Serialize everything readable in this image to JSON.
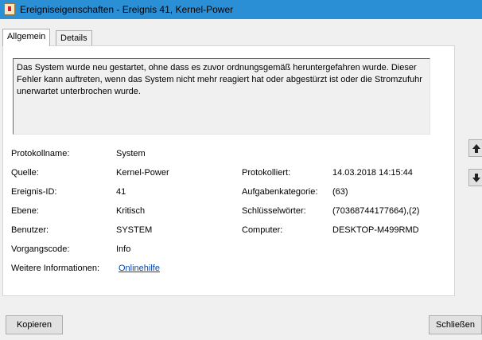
{
  "window": {
    "title": "Ereigniseigenschaften - Ereignis 41, Kernel-Power",
    "icon": "event-log-icon"
  },
  "tabs": [
    {
      "label": "Allgemein",
      "active": true
    },
    {
      "label": "Details",
      "active": false
    }
  ],
  "description": "Das System wurde neu gestartet, ohne dass es zuvor ordnungsgemäß heruntergefahren wurde. Dieser Fehler kann auftreten, wenn das System nicht mehr reagiert hat oder abgestürzt ist oder die Stromzufuhr unerwartet unterbrochen wurde.",
  "fields": {
    "protokollname": {
      "label": "Protokollname:",
      "value": "System"
    },
    "quelle": {
      "label": "Quelle:",
      "value": "Kernel-Power"
    },
    "protokolliert": {
      "label": "Protokolliert:",
      "value": "14.03.2018 14:15:44"
    },
    "ereignis_id": {
      "label": "Ereignis-ID:",
      "value": "41"
    },
    "aufgabenkategorie": {
      "label": "Aufgabenkategorie:",
      "value": "(63)"
    },
    "ebene": {
      "label": "Ebene:",
      "value": "Kritisch"
    },
    "schluesselwoerter": {
      "label": "Schlüsselwörter:",
      "value": "(70368744177664),(2)"
    },
    "benutzer": {
      "label": "Benutzer:",
      "value": "SYSTEM"
    },
    "computer": {
      "label": "Computer:",
      "value": "DESKTOP-M499RMD"
    },
    "vorgangscode": {
      "label": "Vorgangscode:",
      "value": "Info"
    },
    "weitere_informationen": {
      "label": "Weitere Informationen:",
      "link": "Onlinehilfe"
    }
  },
  "side_buttons": [
    {
      "icon": "arrow-up-icon"
    },
    {
      "icon": "arrow-down-icon"
    }
  ],
  "buttons": {
    "copy": "Kopieren",
    "close": "Schließen"
  },
  "colors": {
    "titlebar": "#2b8fd6",
    "link": "#0645ad",
    "window_bg": "#f0f0f0"
  }
}
